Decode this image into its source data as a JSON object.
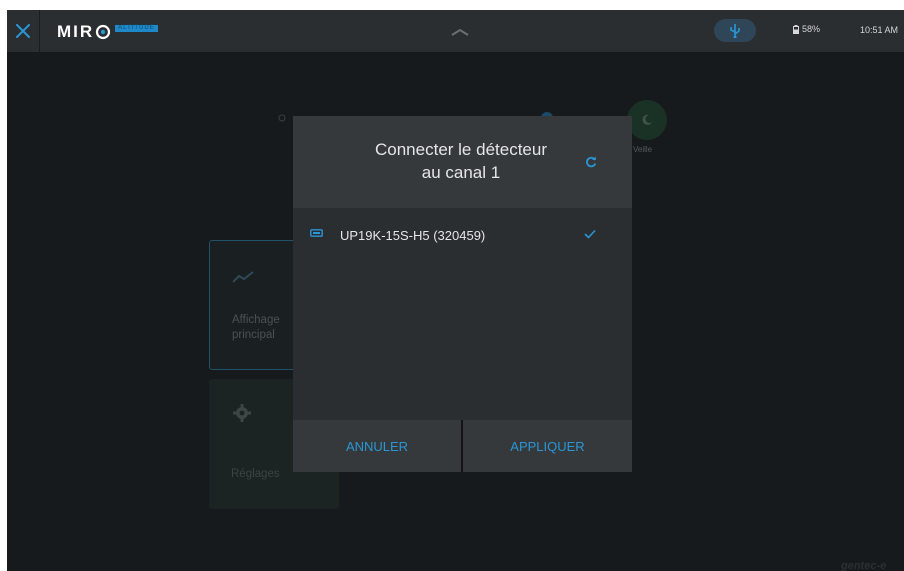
{
  "topbar": {
    "logo_text": "MIR",
    "logo_badge": "ALTITUDE",
    "battery_label": "58%",
    "time": "10:51 AM",
    "icons": {
      "close": "close-icon",
      "chevron": "chevron-up-icon",
      "usb": "usb-icon",
      "battery": "battery-icon"
    }
  },
  "background": {
    "veille_label": "Veille",
    "affichage_label": "Affichage principal",
    "reglages_label": "Réglages",
    "watermark": "gentec-e"
  },
  "dialog": {
    "title_line1": "Connecter le détecteur",
    "title_line2": "au canal 1",
    "devices": [
      {
        "label": "UP19K-15S-H5 (320459)",
        "selected": true
      }
    ],
    "cancel_label": "ANNULER",
    "apply_label": "APPLIQUER"
  },
  "colors": {
    "accent": "#2a96d6",
    "background": "#1f2326",
    "dialog": "#2d3033"
  }
}
